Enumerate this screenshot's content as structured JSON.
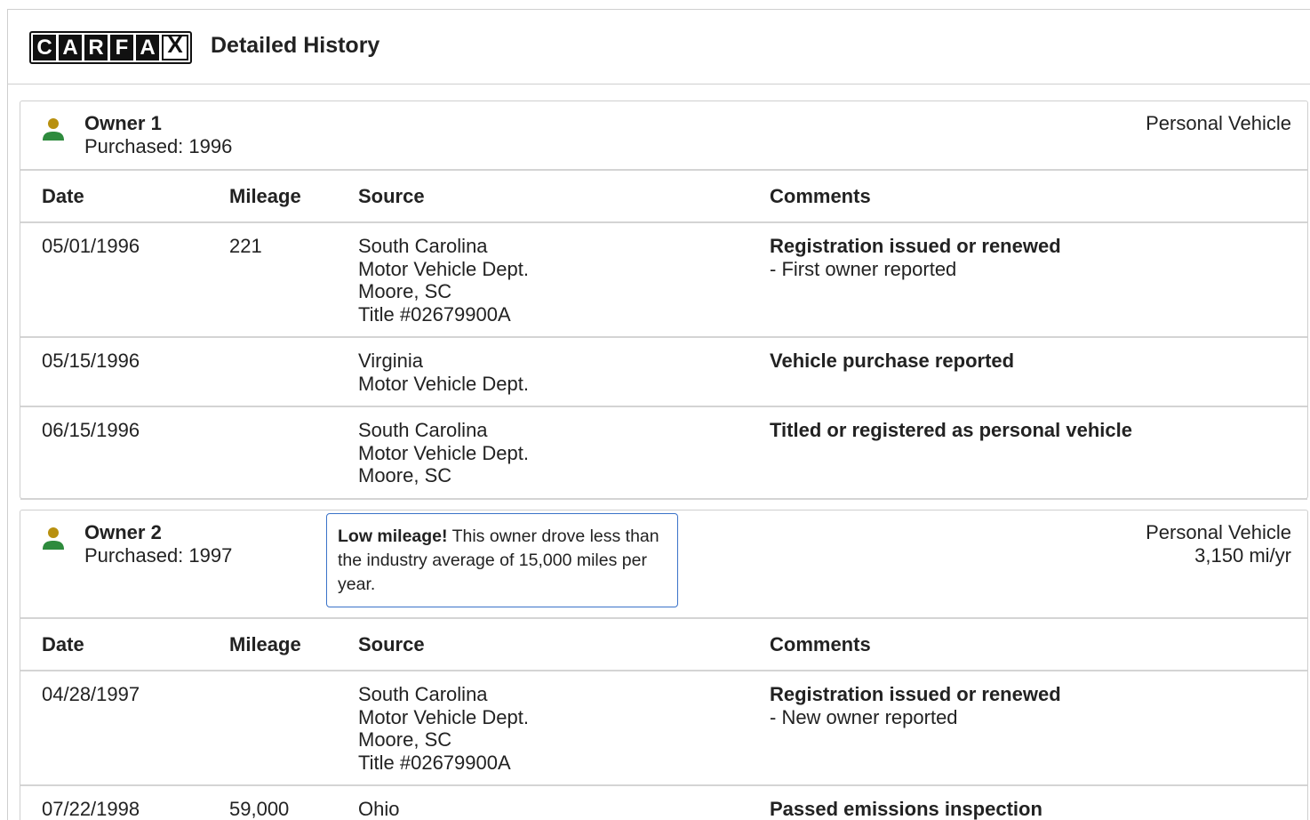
{
  "header": {
    "logo_letters": [
      "C",
      "A",
      "R",
      "F",
      "A",
      "X"
    ],
    "title": "Detailed History"
  },
  "table_headers": {
    "date": "Date",
    "mileage": "Mileage",
    "source": "Source",
    "comments": "Comments"
  },
  "owners": [
    {
      "name": "Owner 1",
      "purchased": "Purchased: 1996",
      "type": "Personal Vehicle",
      "rate": "",
      "records": [
        {
          "date": "05/01/1996",
          "mileage": "221",
          "source": [
            "South Carolina",
            "Motor Vehicle Dept.",
            "Moore, SC",
            "Title #02679900A"
          ],
          "comment_title": "Registration issued or renewed",
          "comment_note": "- First owner reported"
        },
        {
          "date": "05/15/1996",
          "mileage": "",
          "source": [
            "Virginia",
            "Motor Vehicle Dept."
          ],
          "comment_title": "Vehicle purchase reported",
          "comment_note": ""
        },
        {
          "date": "06/15/1996",
          "mileage": "",
          "source": [
            "South Carolina",
            "Motor Vehicle Dept.",
            "Moore, SC"
          ],
          "comment_title": "Titled or registered as personal vehicle",
          "comment_note": ""
        }
      ]
    },
    {
      "name": "Owner 2",
      "purchased": "Purchased: 1997",
      "type": "Personal Vehicle",
      "rate": "3,150 mi/yr",
      "callout": {
        "bold": "Low mileage!",
        "text": " This owner drove less than the industry average of 15,000 miles per year."
      },
      "records": [
        {
          "date": "04/28/1997",
          "mileage": "",
          "source": [
            "South Carolina",
            "Motor Vehicle Dept.",
            "Moore, SC",
            "Title #02679900A"
          ],
          "comment_title": "Registration issued or renewed",
          "comment_note": "- New owner reported"
        },
        {
          "date": "07/22/1998",
          "mileage": "59,000",
          "source": [
            "Ohio"
          ],
          "comment_title": "Passed emissions inspection",
          "comment_note": ""
        }
      ]
    }
  ],
  "colors": {
    "person_head": "#b8900f",
    "person_body": "#2e8b3d",
    "callout_border": "#3b73c9",
    "divider": "#d4d4d4"
  },
  "icons": {
    "owner": "person-icon"
  }
}
